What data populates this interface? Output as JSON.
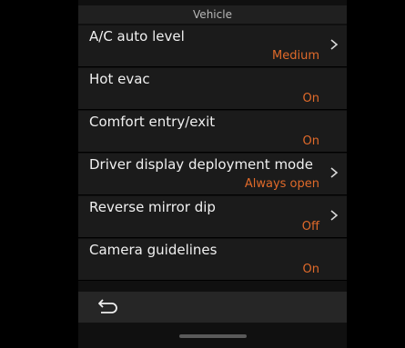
{
  "header": {
    "title": "Vehicle"
  },
  "items": [
    {
      "label": "A/C auto level",
      "value": "Medium",
      "has_chevron": true
    },
    {
      "label": "Hot evac",
      "value": "On",
      "has_chevron": false
    },
    {
      "label": "Comfort entry/exit",
      "value": "On",
      "has_chevron": false
    },
    {
      "label": "Driver display deployment mode",
      "value": "Always open",
      "has_chevron": true
    },
    {
      "label": "Reverse mirror dip",
      "value": "Off",
      "has_chevron": true
    },
    {
      "label": "Camera guidelines",
      "value": "On",
      "has_chevron": false
    }
  ],
  "footer": {
    "back_icon": "back-arrow-icon"
  },
  "colors": {
    "accent": "#e06a2a",
    "row_bg": "#1b1b1b",
    "header_bg": "#202020",
    "footer_bg": "#262626"
  }
}
